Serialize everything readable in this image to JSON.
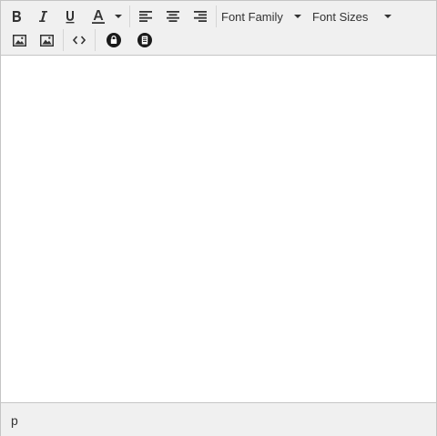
{
  "toolbar": {
    "font_family_label": "Font Family",
    "font_sizes_label": "Font Sizes",
    "buttons": [
      "bold",
      "italic",
      "underline",
      "text-color",
      "align-left",
      "align-center",
      "align-right",
      "image",
      "insert-image",
      "source-code",
      "lock",
      "document"
    ]
  },
  "statusbar": {
    "path": "p"
  },
  "colors": {
    "toolbar_bg": "#f0f0f0",
    "border": "#c5c5c5",
    "icon": "#333333",
    "text_color_underline": "#333333"
  }
}
